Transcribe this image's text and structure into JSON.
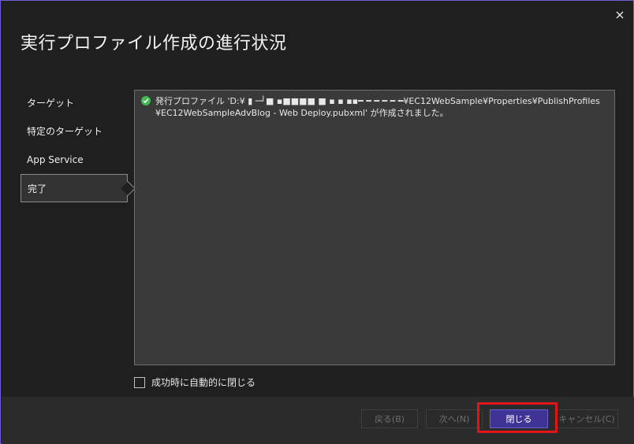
{
  "dialog": {
    "title": "実行プロファイル作成の進行状況"
  },
  "steps": [
    {
      "label": "ターゲット"
    },
    {
      "label": "特定のターゲット"
    },
    {
      "label": "App Service"
    },
    {
      "label": "完了"
    }
  ],
  "log": {
    "line1": "発行プロファイル 'D:¥ ▮ ─┘■ ▪■■■■ ■ ▪ ▪ ▪▪━ ━ ━ ━ ━ ━¥EC12WebSample¥Properties¥PublishProfiles",
    "line2": "¥EC12WebSampleAdvBlog - Web Deploy.pubxml' が作成されました。"
  },
  "options": {
    "auto_close_label": "成功時に自動的に閉じる",
    "auto_close_checked": false
  },
  "buttons": {
    "back": "戻る(B)",
    "next": "次へ(N)",
    "close": "閉じる",
    "cancel": "キャンセル(C)"
  },
  "colors": {
    "accent": "#6b5fd6",
    "primary_button": "#3f3496",
    "success": "#3fb950",
    "highlight": "#e01616"
  }
}
